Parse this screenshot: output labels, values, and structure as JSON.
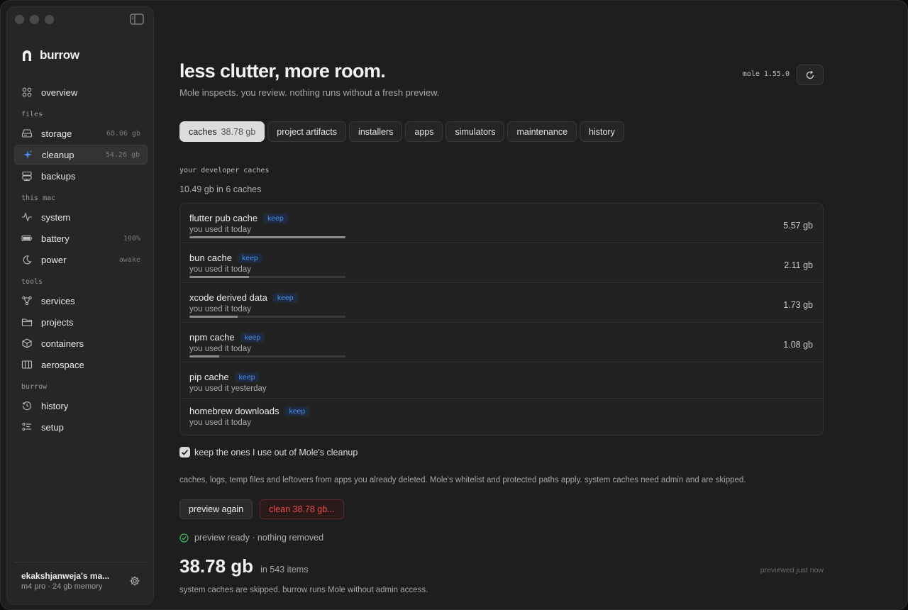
{
  "app": {
    "name": "burrow"
  },
  "sidebar": {
    "sections": {
      "files": "files",
      "this_mac": "this mac",
      "tools": "tools",
      "burrow": "burrow"
    },
    "overview": {
      "label": "overview"
    },
    "storage": {
      "label": "storage",
      "meta": "68.06 gb"
    },
    "cleanup": {
      "label": "cleanup",
      "meta": "54.26 gb"
    },
    "backups": {
      "label": "backups"
    },
    "system": {
      "label": "system"
    },
    "battery": {
      "label": "battery",
      "meta": "100%"
    },
    "power": {
      "label": "power",
      "meta": "awake"
    },
    "services": {
      "label": "services"
    },
    "projects": {
      "label": "projects"
    },
    "containers": {
      "label": "containers"
    },
    "aerospace": {
      "label": "aerospace"
    },
    "history": {
      "label": "history"
    },
    "setup": {
      "label": "setup"
    },
    "footer": {
      "user": "ekakshjanweja's ma...",
      "machine": "m4 pro · 24 gb memory"
    }
  },
  "header": {
    "title": "less clutter, more room.",
    "subtitle": "Mole inspects. you review. nothing runs without a fresh preview.",
    "version": "mole 1.55.0"
  },
  "tabs": [
    {
      "label": "caches",
      "count": "38.78 gb"
    },
    {
      "label": "project artifacts"
    },
    {
      "label": "installers"
    },
    {
      "label": "apps"
    },
    {
      "label": "simulators"
    },
    {
      "label": "maintenance"
    },
    {
      "label": "history"
    }
  ],
  "caches": {
    "heading": "your developer caches",
    "summary": "10.49 gb in 6 caches",
    "keep_label": "keep",
    "items": [
      {
        "name": "flutter pub cache",
        "used": "you used it today",
        "size": "5.57 gb",
        "share": 1.0
      },
      {
        "name": "bun cache",
        "used": "you used it today",
        "size": "2.11 gb",
        "share": 0.38
      },
      {
        "name": "xcode derived data",
        "used": "you used it today",
        "size": "1.73 gb",
        "share": 0.31
      },
      {
        "name": "npm cache",
        "used": "you used it today",
        "size": "1.08 gb",
        "share": 0.19
      },
      {
        "name": "pip cache",
        "used": "you used it yesterday"
      },
      {
        "name": "homebrew downloads",
        "used": "you used it today"
      }
    ]
  },
  "keep_check": {
    "label": "keep the ones I use out of Mole's cleanup",
    "checked": true
  },
  "description": "caches, logs, temp files and leftovers from apps you already deleted. Mole's whitelist and protected paths apply. system caches need admin and are skipped.",
  "actions": {
    "preview": "preview again",
    "clean": "clean 38.78 gb..."
  },
  "status": "preview ready · nothing removed",
  "total": {
    "amount": "38.78 gb",
    "items": "in 543 items",
    "previewed": "previewed just now"
  },
  "footnote": "system caches are skipped. burrow runs Mole without admin access.",
  "colors": {
    "accent_blue": "#4b8ff0",
    "danger": "#ec4b4b",
    "success": "#3fbf5a"
  }
}
